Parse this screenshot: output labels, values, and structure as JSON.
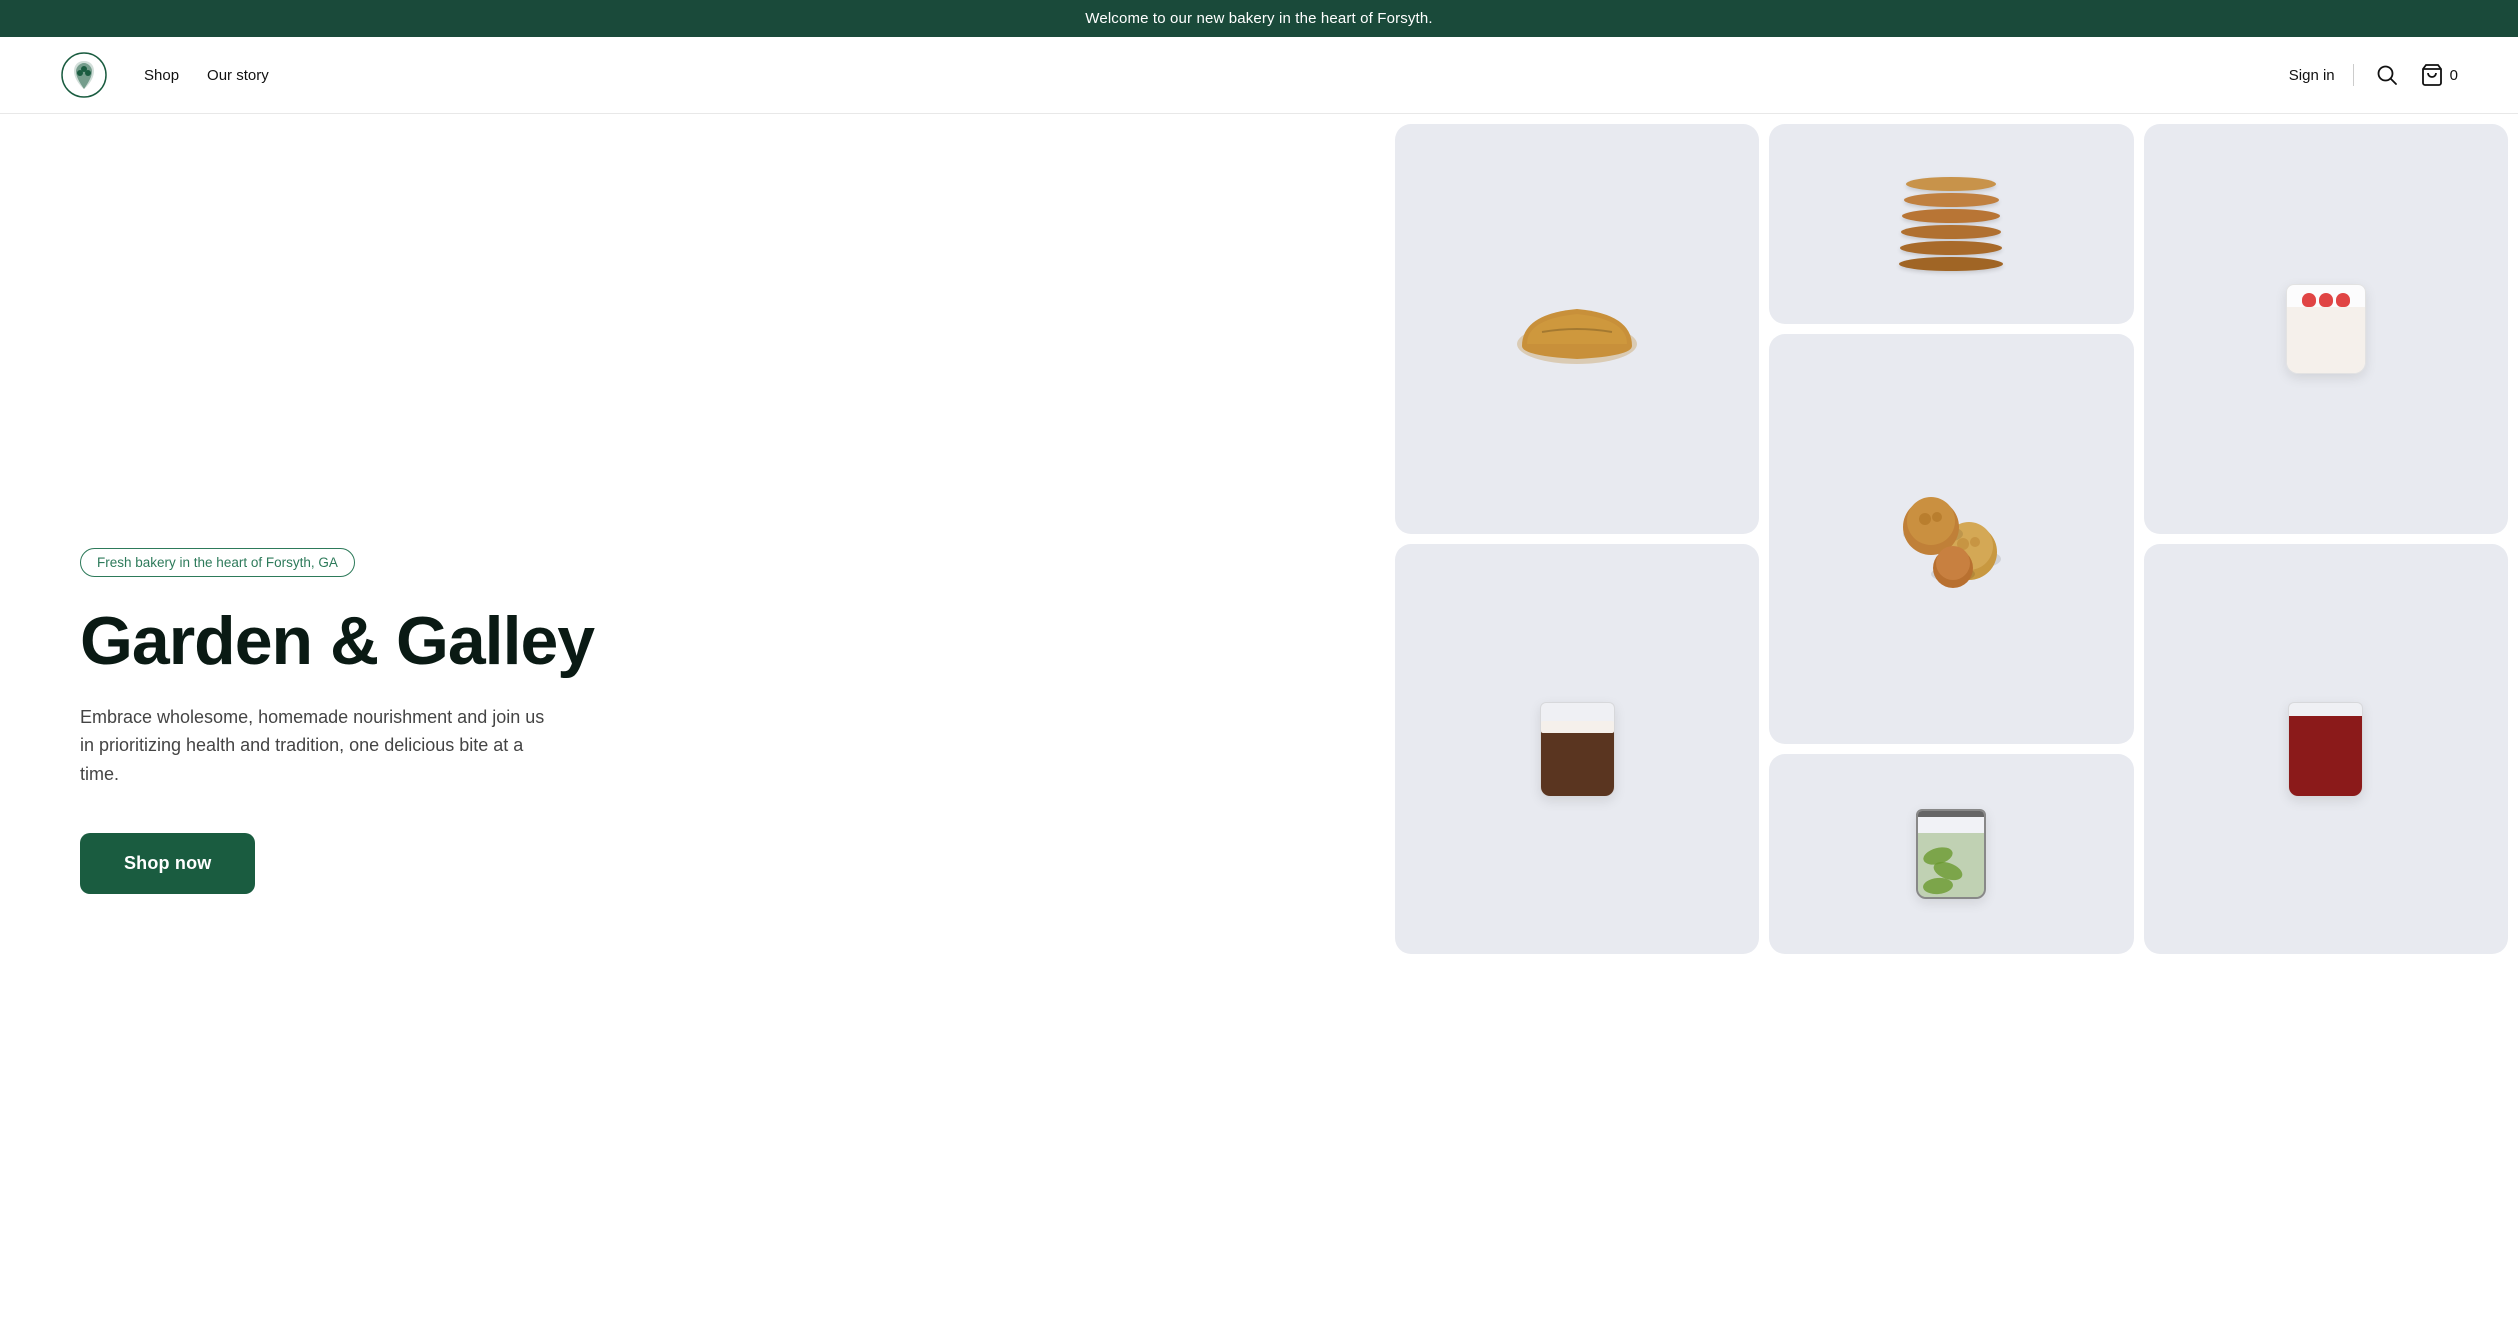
{
  "announcement": {
    "text": "Welcome to our new bakery in the heart of Forsyth."
  },
  "nav": {
    "shop_label": "Shop",
    "our_story_label": "Our story",
    "sign_in_label": "Sign in",
    "cart_count": "0"
  },
  "hero": {
    "badge_text": "Fresh bakery in the heart of Forsyth, GA",
    "title": "Garden & Galley",
    "description": "Embrace wholesome, homemade nourishment and join us in prioritizing health and tradition, one delicious bite at a time.",
    "cta_label": "Shop now"
  },
  "products": [
    {
      "id": "pancakes",
      "alt": "Pancake stack"
    },
    {
      "id": "bread",
      "alt": "Bread loaf"
    },
    {
      "id": "yogurt",
      "alt": "Yogurt with strawberries"
    },
    {
      "id": "muffins",
      "alt": "English muffins"
    },
    {
      "id": "choc-drink",
      "alt": "Chocolate drink"
    },
    {
      "id": "red-drink",
      "alt": "Red juice drink"
    },
    {
      "id": "jar",
      "alt": "Pickle jar"
    }
  ],
  "colors": {
    "brand_dark": "#1a4a3a",
    "brand_green": "#1a5c40",
    "badge_green": "#2d7a5a"
  }
}
